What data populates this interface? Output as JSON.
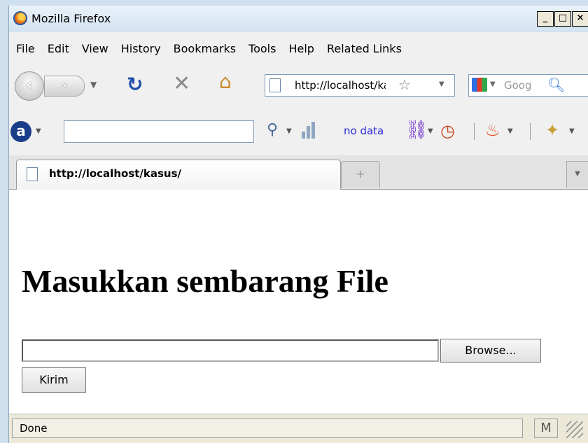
{
  "window": {
    "title": "Mozilla Firefox",
    "controls": [
      "_",
      "□",
      "×"
    ]
  },
  "menu": [
    {
      "label": "File"
    },
    {
      "label": "Edit"
    },
    {
      "label": "View"
    },
    {
      "label": "History"
    },
    {
      "label": "Bookmarks"
    },
    {
      "label": "Tools"
    },
    {
      "label": "Help"
    },
    {
      "label": "Related Links"
    }
  ],
  "nav": {
    "back_glyph": "‹",
    "forward_glyph": "›",
    "url": "http://localhost/kasus/",
    "search_placeholder": "Goog"
  },
  "toolbar2": {
    "status_link": "no data"
  },
  "tab": {
    "label": "http://localhost/kasus/",
    "new_tab_glyph": "+"
  },
  "page": {
    "heading": "Masukkan sembarang File",
    "browse_label": "Browse...",
    "submit_label": "Kirim"
  },
  "status": {
    "text": "Done",
    "mail_glyph": "M"
  },
  "icons": {
    "reload": "reload-icon",
    "stop": "stop-icon",
    "home": "home-icon",
    "bookmark_star": "star-icon",
    "search_go": "magnifier-icon"
  },
  "colors": {
    "title_bar": "#d3e2f1",
    "link": "#2a2ad8",
    "reload": "#1f4ea8"
  }
}
